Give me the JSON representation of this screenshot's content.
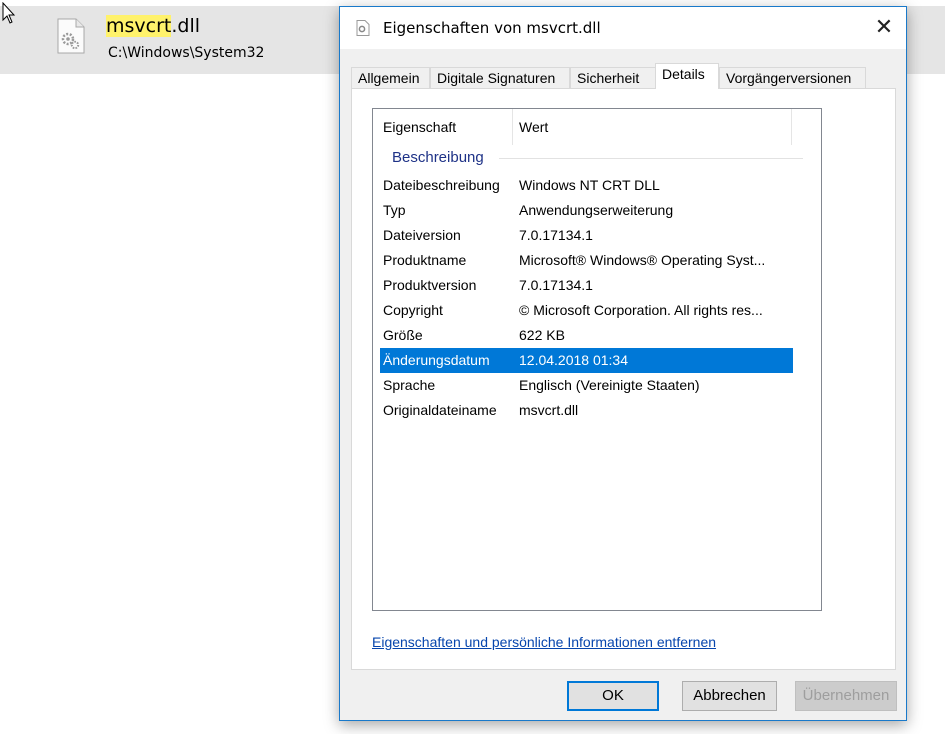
{
  "search_result": {
    "name_highlight": "msvcrt",
    "name_rest": ".dll",
    "path": "C:\\Windows\\System32"
  },
  "dialog": {
    "title": "Eigenschaften von msvcrt.dll",
    "close_symbol": "✕",
    "tabs": [
      {
        "label": "Allgemein"
      },
      {
        "label": "Digitale Signaturen"
      },
      {
        "label": "Sicherheit"
      },
      {
        "label": "Details",
        "active": true
      },
      {
        "label": "Vorgängerversionen"
      }
    ],
    "list": {
      "header": {
        "property": "Eigenschaft",
        "value": "Wert"
      },
      "group": "Beschreibung",
      "rows": [
        {
          "key": "Dateibeschreibung",
          "value": "Windows NT CRT DLL"
        },
        {
          "key": "Typ",
          "value": "Anwendungserweiterung"
        },
        {
          "key": "Dateiversion",
          "value": "7.0.17134.1"
        },
        {
          "key": "Produktname",
          "value": "Microsoft® Windows® Operating Syst..."
        },
        {
          "key": "Produktversion",
          "value": "7.0.17134.1"
        },
        {
          "key": "Copyright",
          "value": "© Microsoft Corporation. All rights res..."
        },
        {
          "key": "Größe",
          "value": "622 KB"
        },
        {
          "key": "Änderungsdatum",
          "value": "12.04.2018 01:34",
          "selected": true
        },
        {
          "key": "Sprache",
          "value": "Englisch (Vereinigte Staaten)"
        },
        {
          "key": "Originaldateiname",
          "value": "msvcrt.dll"
        }
      ]
    },
    "remove_link": "Eigenschaften und persönliche Informationen entfernen",
    "buttons": {
      "ok": "OK",
      "cancel": "Abbrechen",
      "apply": "Übernehmen"
    }
  },
  "colors": {
    "selection": "#0078d7",
    "highlight": "#fff26b",
    "group_text": "#1e3287",
    "link": "#0645ad"
  }
}
